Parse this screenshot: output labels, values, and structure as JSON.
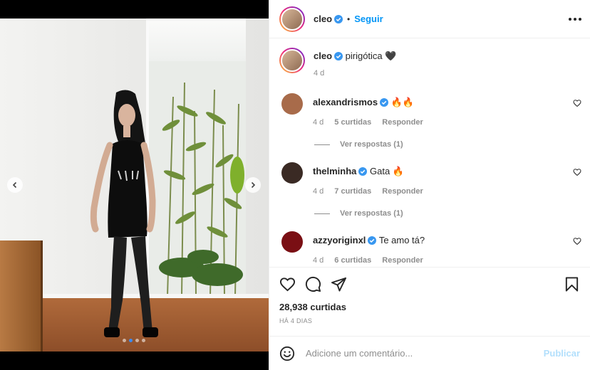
{
  "post": {
    "author": "cleo",
    "follow_label": "Seguir",
    "separator": "•",
    "caption": {
      "username": "cleo",
      "text": "pirigótica 🖤",
      "time": "4 d"
    },
    "image_carousel": {
      "slides": 4,
      "active_index": 2
    }
  },
  "comments": [
    {
      "username": "alexandrismos",
      "text": "🔥🔥",
      "time": "4 d",
      "likes": "5 curtidas",
      "reply_label": "Responder",
      "view_replies": "Ver respostas (1)",
      "avatar_color": "#a86b4a"
    },
    {
      "username": "thelminha",
      "text": "Gata 🔥",
      "time": "4 d",
      "likes": "7 curtidas",
      "reply_label": "Responder",
      "view_replies": "Ver respostas (1)",
      "avatar_color": "#3a2a24"
    },
    {
      "username": "azzyoriginxl",
      "text": "Te amo tá?",
      "time": "4 d",
      "likes": "6 curtidas",
      "reply_label": "Responder",
      "avatar_color": "#7a0f14"
    }
  ],
  "stats": {
    "likes": "28,938 curtidas",
    "posted_ago": "HÁ 4 DIAS"
  },
  "composer": {
    "placeholder": "Adicione um comentário...",
    "publish_label": "Publicar"
  },
  "colors": {
    "accent": "#0095f6",
    "verified": "#3897f0",
    "publish_disabled": "#b2dffc",
    "muted_text": "#8e8e8e"
  },
  "icons": [
    "chevron-left-icon",
    "chevron-right-icon",
    "verified-icon",
    "more-options-icon",
    "heart-icon",
    "comment-icon",
    "share-icon",
    "bookmark-icon",
    "emoji-icon"
  ]
}
